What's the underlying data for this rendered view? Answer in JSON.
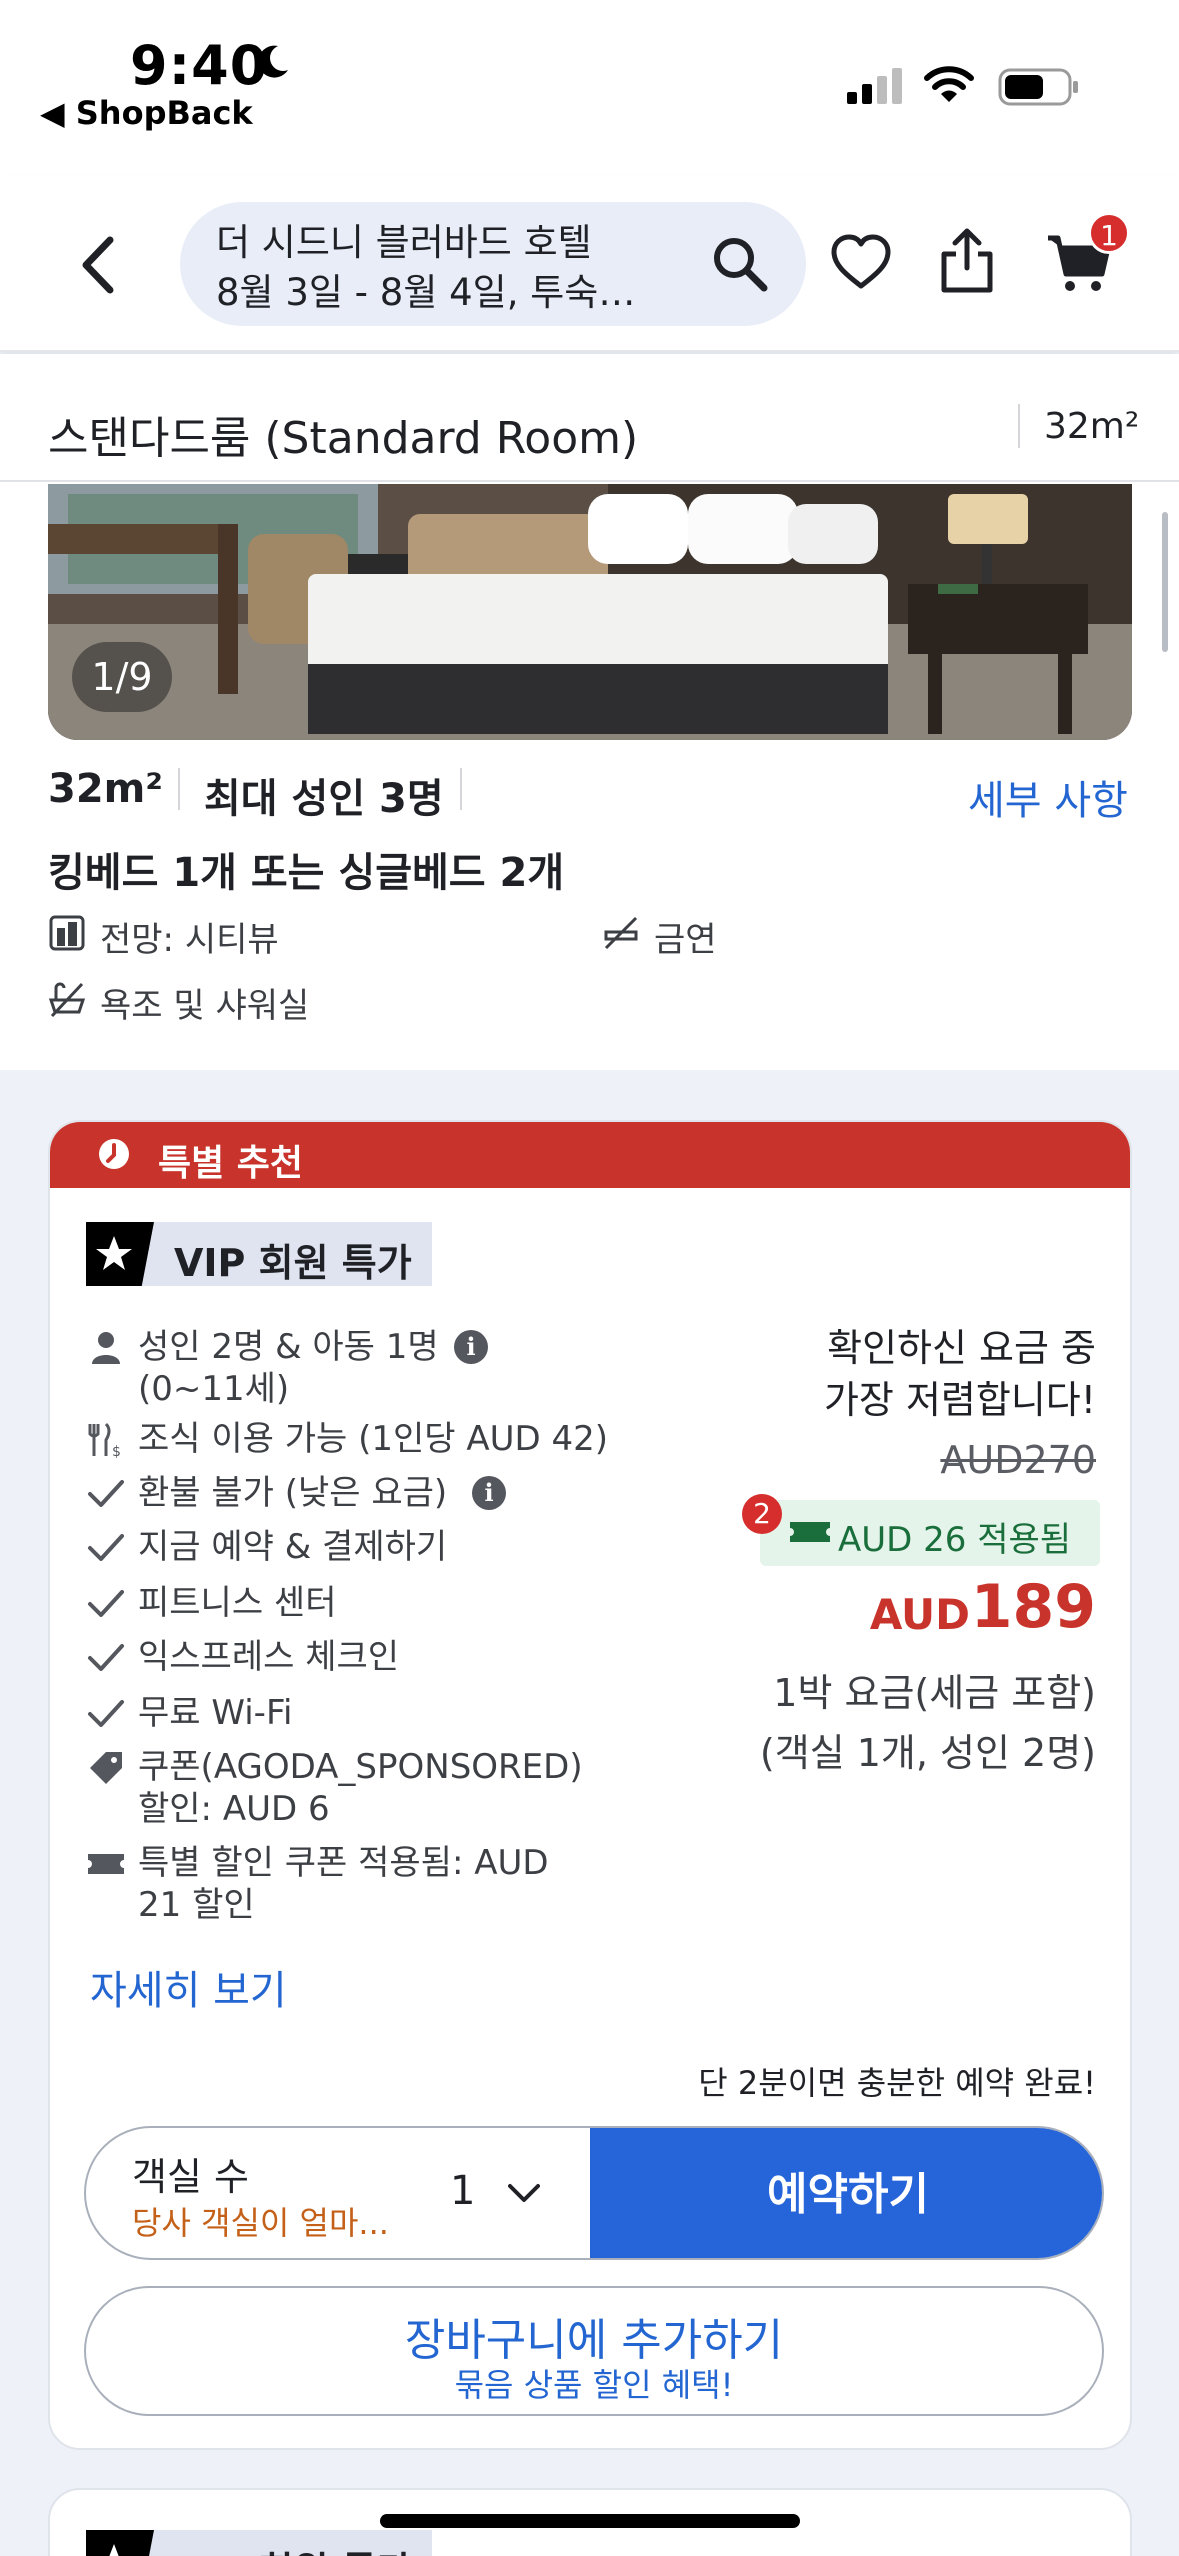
{
  "status_bar": {
    "time": "9:40",
    "back_app": "ShopBack"
  },
  "header": {
    "search_title": "더 시드니 블러바드 호텔",
    "search_sub": "8월 3일 - 8월 4일, 투숙…",
    "cart_count": "1"
  },
  "room": {
    "title": "스탠다드룸 (Standard Room)",
    "size_top": "32m²",
    "photo_counter": "1/9",
    "size": "32m²",
    "max_guests": "최대 성인 3명",
    "details_link": "세부 사항",
    "beds": "킹베드 1개 또는 싱글베드 2개",
    "features": [
      "전망: 시티뷰",
      "금연",
      "욕조 및 샤워실"
    ]
  },
  "offer": {
    "banner": "특별 추천",
    "badge": "VIP 회원 특가",
    "perks": {
      "guests_line1": "성인 2명 & 아동 1명",
      "guests_line2": "(0~11세)",
      "breakfast": "조식 이용 가능 (1인당 AUD 42)",
      "refund": "환불 불가 (낮은 요금)",
      "pay_now": "지금 예약 & 결제하기",
      "fitness": "피트니스 센터",
      "express": "익스프레스 체크인",
      "wifi": "무료 Wi-Fi",
      "coupon_line1": "쿠폰(AGODA_SPONSORED)",
      "coupon_line2": "할인: AUD 6",
      "special_line1": "특별 할인 쿠폰 적용됨: AUD",
      "special_line2": "21 할인"
    },
    "more_link": "자세히 보기",
    "cheapest_line1": "확인하신 요금 중",
    "cheapest_line2": "가장 저렴합니다!",
    "original_price": "AUD270",
    "coupon_badge": "2",
    "coupon_applied": "AUD 26 적용됨",
    "currency": "AUD",
    "price": "189",
    "per_night": "1박 요금(세금 포함)",
    "per_room": "(객실 1개, 성인 2명)",
    "quick_note": "단 2분이면 충분한 예약 완료!",
    "rooms_label": "객실 수",
    "rooms_sub": "당사 객실이 얼마...",
    "rooms_value": "1",
    "book_button": "예약하기",
    "add_cart_main": "장바구니에 추가하기",
    "add_cart_sub": "묶음 상품 할인 혜택!"
  },
  "next_offer": {
    "badge": "VIP 회원 특가"
  },
  "colors": {
    "accent_blue": "#2565d9",
    "price_red": "#c8342b",
    "coupon_green": "#1a6e3b"
  }
}
